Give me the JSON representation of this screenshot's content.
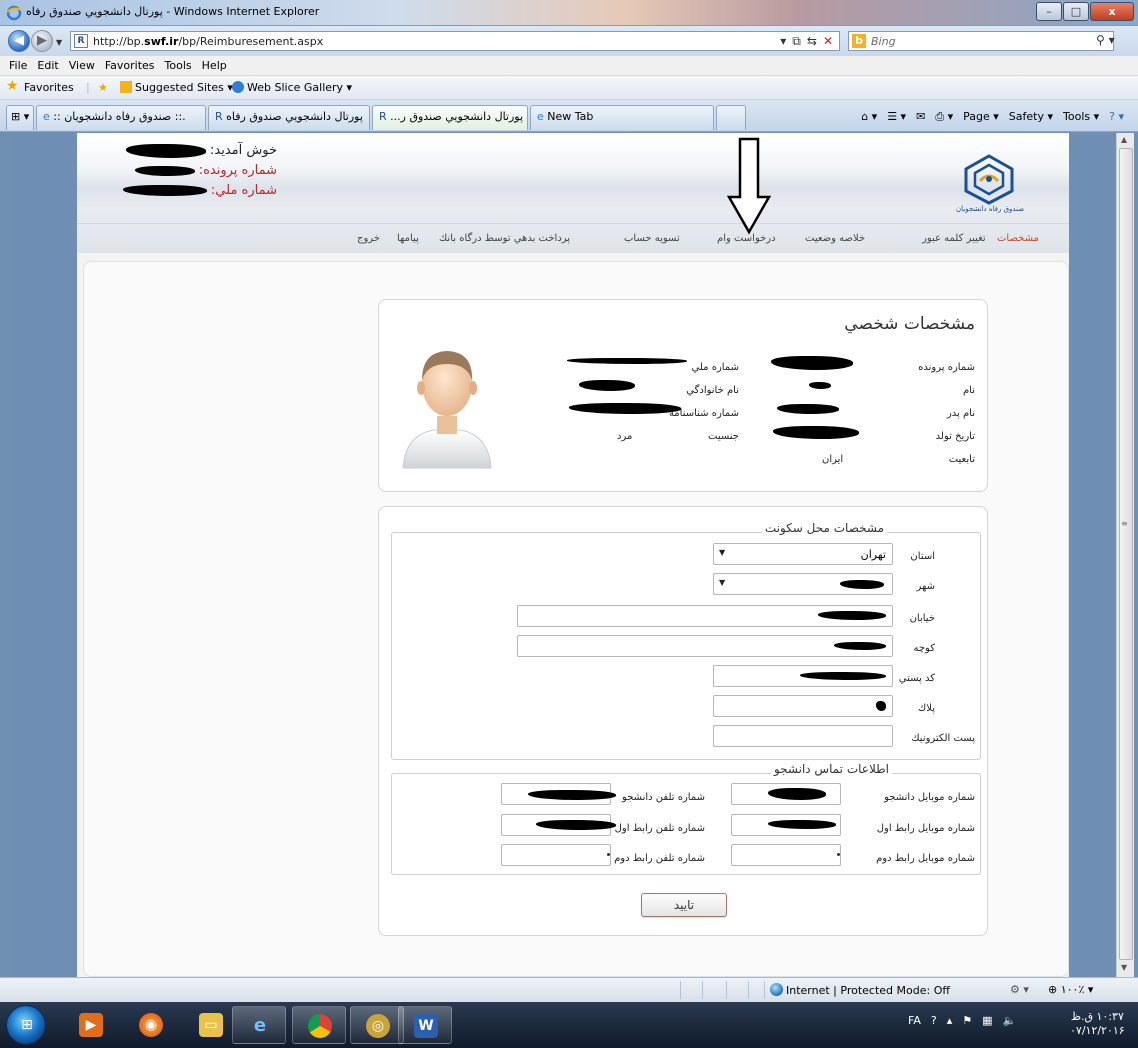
{
  "window": {
    "title": "پورتال دانشجويي صندوق رفاه - Windows Internet Explorer",
    "min": "–",
    "max": "□",
    "close": "x"
  },
  "address": {
    "url_prefix": "http://bp.",
    "url_domain": "swf.ir",
    "url_path": "/bp/Reimburesement.aspx",
    "search_placeholder": "Bing"
  },
  "menu": [
    "File",
    "Edit",
    "View",
    "Favorites",
    "Tools",
    "Help"
  ],
  "favorites": {
    "label": "Favorites",
    "suggested": "Suggested Sites ▾",
    "webslice": "Web Slice Gallery ▾"
  },
  "tabs": [
    {
      "label": ":: صندوق رفاه دانشجويان ::."
    },
    {
      "label": "پورتال دانشجويي صندوق رفاه"
    },
    {
      "label": "...پورتال دانشجويي صندوق ر"
    },
    {
      "label": "New Tab"
    }
  ],
  "commands": {
    "page": "Page ▾",
    "safety": "Safety ▾",
    "tools": "Tools ▾"
  },
  "site": {
    "welcome_label": "خوش آمديد:",
    "file_label": "شماره پرونده:",
    "national_label": "شماره ملي:",
    "logo_caption": "صندوق رفاه دانشجويان",
    "nav": {
      "profile": "مشخصات",
      "change_password": "تغيير كلمه عبور",
      "status_summary": "خلاصه وضعيت",
      "loan_request": "درخواست وام",
      "settlement": "تسويه حساب",
      "debt_payment": "پرداخت بدهي توسط درگاه بانك",
      "messages": "پيامها",
      "logout": "خروج"
    }
  },
  "personal": {
    "title": "مشخصات شخصي",
    "labels": {
      "file_number": "شماره پرونده",
      "first_name": "نام",
      "father_name": "نام پدر",
      "birth_date": "تاريخ تولد",
      "nationality": "تابعيت",
      "national_id": "شماره ملي",
      "last_name": "نام خانوادگي",
      "id_number": "شماره شناسنامه",
      "gender": "جنسيت"
    },
    "values": {
      "nationality": "ايران",
      "gender": "مرد"
    }
  },
  "residence": {
    "legend": "مشخصات محل سكونت",
    "labels": {
      "province": "استان",
      "city": "شهر",
      "street": "خيابان",
      "alley": "كوچه",
      "postal_code": "كد پستي",
      "plaque": "پلاك",
      "email": "پست الكترونيك"
    },
    "province_value": "تهران"
  },
  "contact": {
    "legend": "اطلاعات تماس دانشجو",
    "labels": {
      "student_mobile": "شماره موبايل دانشجو",
      "first_contact_mobile": "شماره موبايل رابط اول",
      "second_contact_mobile": "شماره موبايل رابط دوم",
      "student_phone": "شماره تلفن دانشجو",
      "first_contact_phone": "شماره تلفن رابط اول",
      "second_contact_phone": "شماره تلفن رابط دوم"
    }
  },
  "confirm_label": "تاييد",
  "status": {
    "zone": "Internet | Protected Mode: Off",
    "zoom": "۱۰۰٪ ▾"
  },
  "taskbar": {
    "lang": "FA",
    "time": "۱۰:۳۷ ق.ظ",
    "date": "۰۷/۱۲/۲۰۱۶"
  }
}
